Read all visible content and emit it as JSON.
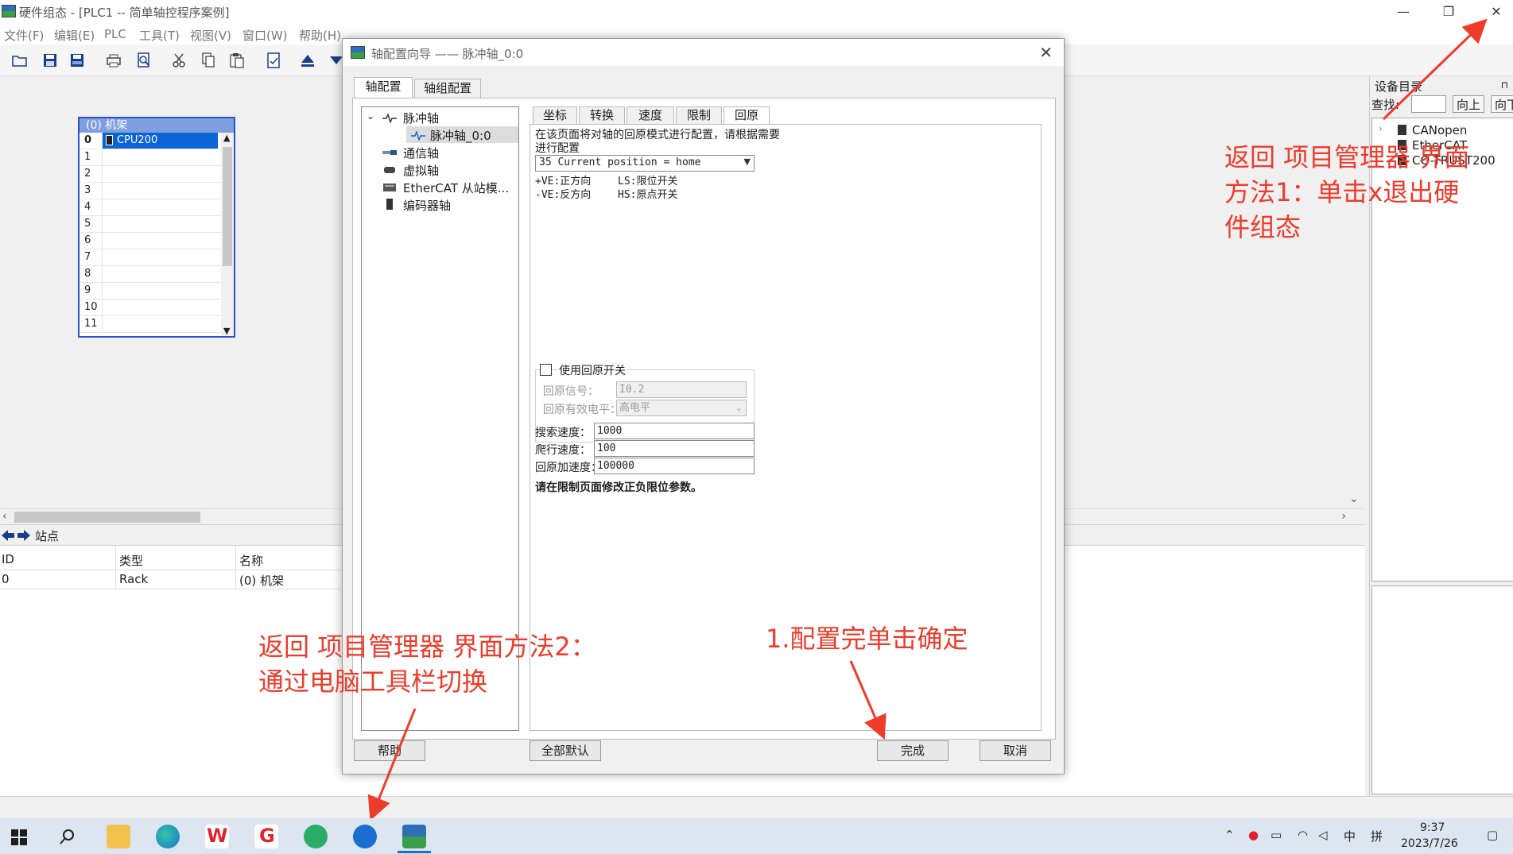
{
  "window": {
    "title": "硬件组态 - [PLC1 -- 简单轴控程序案例]",
    "minimize": "—",
    "restore": "❐",
    "close": "✕"
  },
  "menu": [
    "文件(F)",
    "编辑(E)",
    "PLC",
    "工具(T)",
    "视图(V)",
    "窗口(W)",
    "帮助(H)"
  ],
  "toolbar_icons": [
    "open-icon",
    "save-icon",
    "save-all-icon",
    "print-icon",
    "print-preview-icon",
    "cut-icon",
    "copy-icon",
    "paste-icon",
    "document-icon",
    "upload-icon",
    "download-icon"
  ],
  "rack": {
    "title": "(0) 机架",
    "rows": [
      {
        "index": "0",
        "module": "CPU200"
      },
      {
        "index": "1",
        "module": ""
      },
      {
        "index": "2",
        "module": ""
      },
      {
        "index": "3",
        "module": ""
      },
      {
        "index": "4",
        "module": ""
      },
      {
        "index": "5",
        "module": ""
      },
      {
        "index": "6",
        "module": ""
      },
      {
        "index": "7",
        "module": ""
      },
      {
        "index": "8",
        "module": ""
      },
      {
        "index": "9",
        "module": ""
      },
      {
        "index": "10",
        "module": ""
      },
      {
        "index": "11",
        "module": ""
      }
    ]
  },
  "station": {
    "title": "站点",
    "columns": [
      "ID",
      "类型",
      "名称"
    ],
    "rows": [
      [
        "0",
        "Rack",
        "(0) 机架"
      ]
    ]
  },
  "catalog": {
    "title": "设备目录",
    "search_label": "查找:",
    "up_button": "向上",
    "down_button": "向下",
    "items": [
      "CANopen",
      "EtherCAT",
      "CO-TRUST200"
    ]
  },
  "dialog": {
    "title": "轴配置向导 —— 脉冲轴_0:0",
    "tabs": [
      "轴配置",
      "轴组配置"
    ],
    "tree": {
      "pulse_axis": "脉冲轴",
      "pulse_axis_child": "脉冲轴_0:0",
      "comm_axis": "通信轴",
      "virtual_axis": "虚拟轴",
      "ethercat_axis": "EtherCAT 从站模...",
      "encoder_axis": "编码器轴"
    },
    "subtabs": [
      "坐标",
      "转换",
      "速度",
      "限制",
      "回原"
    ],
    "active_subtab": "回原",
    "intro": [
      "在该页面将对轴的回原模式进行配置，请根据需要",
      "进行配置"
    ],
    "mode_select": "35 Current position = home",
    "legend": {
      "pve": "+VE:正方向",
      "nve": "-VE:反方向",
      "ls": "LS:限位开关",
      "hs": "HS:原点开关"
    },
    "use_home_switch": "使用回原开关",
    "home_signal_label": "回原信号：",
    "home_signal_value": "I0.2",
    "home_level_label": "回原有效电平：",
    "home_level_value": "高电平",
    "search_speed_label": "搜索速度：",
    "search_speed": "1000",
    "creep_speed_label": "爬行速度：",
    "creep_speed": "100",
    "home_accel_label": "回原加速度：",
    "home_accel": "100000",
    "note": "请在限制页面修改正负限位参数。",
    "buttons": {
      "help": "帮助",
      "defaults": "全部默认",
      "finish": "完成",
      "cancel": "取消"
    }
  },
  "annotations": {
    "method1": [
      "返回 项目管理器 界面",
      "方法1：单击x退出硬",
      "件组态"
    ],
    "method2": [
      "返回 项目管理器 界面方法2：",
      "通过电脑工具栏切换"
    ],
    "step1": "1.配置完单击确定"
  },
  "taskbar": {
    "time": "9:37",
    "date": "2023/7/26",
    "ime": "中",
    "ime_mode": "拼"
  },
  "colors": {
    "accent": "#0a64d8",
    "annotation": "#ee3b2b",
    "rack_border": "#2b4fd0"
  }
}
